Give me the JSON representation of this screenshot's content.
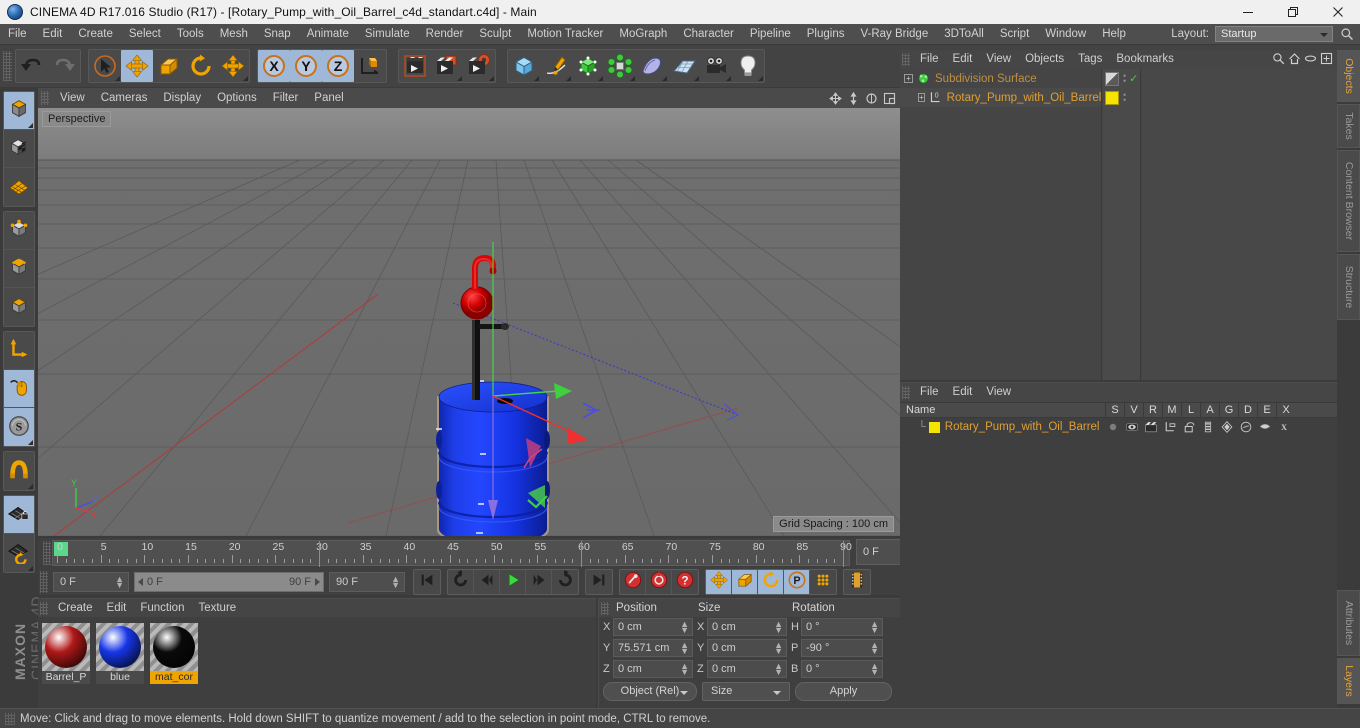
{
  "window": {
    "title": "CINEMA 4D R17.016 Studio (R17) - [Rotary_Pump_with_Oil_Barrel_c4d_standart.c4d] - Main",
    "app_icon": "cinema4d-logo-icon",
    "minimize": "minimize-icon",
    "maximize": "restore-icon",
    "close": "close-icon"
  },
  "menubar": {
    "items": [
      "File",
      "Edit",
      "Create",
      "Select",
      "Tools",
      "Mesh",
      "Snap",
      "Animate",
      "Simulate",
      "Render",
      "Sculpt",
      "Motion Tracker",
      "MoGraph",
      "Character",
      "Pipeline",
      "Plugins",
      "V-Ray Bridge",
      "3DToAll",
      "Script",
      "Window",
      "Help"
    ],
    "layout_label": "Layout:",
    "layout_value": "Startup",
    "search_icon": "search-icon"
  },
  "toolbar": {
    "groups": [
      {
        "name": "history",
        "buttons": [
          {
            "name": "undo-button",
            "icon": "undo-arrow-icon",
            "selected": false,
            "corner": false
          },
          {
            "name": "redo-button",
            "icon": "redo-arrow-icon",
            "selected": false,
            "corner": false
          }
        ]
      },
      {
        "name": "transform",
        "buttons": [
          {
            "name": "live-selection-tool",
            "icon": "cursor-circle-icon",
            "selected": false,
            "corner": true
          },
          {
            "name": "move-tool",
            "icon": "move-arrows-icon",
            "selected": true,
            "corner": false
          },
          {
            "name": "scale-tool",
            "icon": "scale-box-icon",
            "selected": false,
            "corner": false
          },
          {
            "name": "rotate-tool",
            "icon": "rotate-arc-icon",
            "selected": false,
            "corner": false
          },
          {
            "name": "transform-tool",
            "icon": "move-arrows-icon",
            "selected": false,
            "corner": true
          }
        ]
      },
      {
        "name": "axis-lock",
        "buttons": [
          {
            "name": "lock-x-axis",
            "icon": "x-axis-icon",
            "selected": true,
            "corner": false
          },
          {
            "name": "lock-y-axis",
            "icon": "y-axis-icon",
            "selected": true,
            "corner": false
          },
          {
            "name": "lock-z-axis",
            "icon": "z-axis-icon",
            "selected": true,
            "corner": false
          },
          {
            "name": "world-object-coordinates",
            "icon": "axis-cube-icon",
            "selected": false,
            "corner": false
          }
        ]
      },
      {
        "name": "render",
        "buttons": [
          {
            "name": "render-view-button",
            "icon": "clapper-view-icon",
            "selected": false,
            "corner": false
          },
          {
            "name": "render-to-picture-viewer",
            "icon": "clapper-picture-icon",
            "selected": false,
            "corner": true
          },
          {
            "name": "render-settings-button",
            "icon": "clapper-gear-icon",
            "selected": false,
            "corner": true
          }
        ]
      },
      {
        "name": "objects",
        "buttons": [
          {
            "name": "add-cube-object",
            "icon": "blue-cube-icon",
            "selected": false,
            "corner": true
          },
          {
            "name": "add-spline-object",
            "icon": "pen-spline-icon",
            "selected": false,
            "corner": true
          },
          {
            "name": "add-generator-object",
            "icon": "green-cube-icon",
            "selected": false,
            "corner": true
          },
          {
            "name": "add-deformer-object",
            "icon": "green-cluster-icon",
            "selected": false,
            "corner": true
          },
          {
            "name": "add-scene-object",
            "icon": "purple-shape-icon",
            "selected": false,
            "corner": true
          },
          {
            "name": "add-floor-object",
            "icon": "grid-plane-icon",
            "selected": false,
            "corner": true
          },
          {
            "name": "add-camera-object",
            "icon": "camera-icon",
            "selected": false,
            "corner": true
          },
          {
            "name": "add-light-object",
            "icon": "lightbulb-icon",
            "selected": false,
            "corner": true
          }
        ]
      }
    ]
  },
  "leftbar": {
    "groups": [
      [
        {
          "name": "model-mode",
          "icon": "model-cube-icon",
          "selected": true,
          "corner": true
        },
        {
          "name": "texture-mode",
          "icon": "texture-cube-icon",
          "selected": false,
          "corner": false
        },
        {
          "name": "workplane-mode",
          "icon": "workplane-grid-icon",
          "selected": false,
          "corner": false
        }
      ],
      [
        {
          "name": "points-mode",
          "icon": "points-cube-icon",
          "selected": false,
          "corner": false
        },
        {
          "name": "edges-mode",
          "icon": "edges-cube-icon",
          "selected": false,
          "corner": false
        },
        {
          "name": "polygons-mode",
          "icon": "polygons-cube-icon",
          "selected": false,
          "corner": false
        }
      ],
      [
        {
          "name": "object-axis-mode",
          "icon": "axis-l-icon",
          "selected": false,
          "corner": false
        },
        {
          "name": "enable-axis-modification",
          "icon": "mouse-axis-icon",
          "selected": true,
          "corner": false
        },
        {
          "name": "soft-selection-mode",
          "icon": "soft-selection-s-icon",
          "selected": true,
          "corner": true
        }
      ],
      [
        {
          "name": "enable-snapping",
          "icon": "magnet-icon",
          "selected": false,
          "corner": true
        }
      ],
      [
        {
          "name": "lock-workplane",
          "icon": "workplane-lock-icon",
          "selected": true,
          "corner": false
        },
        {
          "name": "workplane-rotate",
          "icon": "workplane-rotate-icon",
          "selected": false,
          "corner": true
        }
      ]
    ],
    "brand_line1": "MAXON",
    "brand_line2": "CINEMA 4D"
  },
  "viewport": {
    "menu": [
      "View",
      "Cameras",
      "Display",
      "Options",
      "Filter",
      "Panel"
    ],
    "corner_icons": [
      "move-viewport-icon",
      "zoom-viewport-icon",
      "rotate-viewport-icon",
      "maximize-viewport-icon"
    ],
    "label": "Perspective",
    "grid_spacing": "Grid Spacing : 100 cm",
    "axis_x": "X",
    "axis_y": "Y",
    "axis_z": "Z"
  },
  "timeline": {
    "start_frame_field": "0 F",
    "range_start": "0 F",
    "range_end": "90 F",
    "end_frame_field": "90 F",
    "current_frame_field": "0 F",
    "ticks": [
      0,
      5,
      10,
      15,
      20,
      25,
      30,
      35,
      40,
      45,
      50,
      55,
      60,
      65,
      70,
      75,
      80,
      85,
      90
    ],
    "transport": [
      {
        "name": "go-to-start-button",
        "icon": "skip-start-icon"
      },
      {
        "name": "play-backwards-loop-button",
        "icon": "loop-back-icon"
      },
      {
        "name": "step-back-button",
        "icon": "step-back-icon"
      },
      {
        "name": "play-button",
        "icon": "play-icon"
      },
      {
        "name": "step-forward-button",
        "icon": "step-forward-icon"
      },
      {
        "name": "play-forwards-loop-button",
        "icon": "loop-forward-icon"
      },
      {
        "name": "go-to-end-button",
        "icon": "skip-end-icon"
      }
    ],
    "record": [
      {
        "name": "record-active-objects-button",
        "icon": "record-key-icon"
      },
      {
        "name": "autokeying-button",
        "icon": "autokey-circle-icon"
      },
      {
        "name": "keyframe-selection-button",
        "icon": "keyframe-question-icon"
      }
    ],
    "keyflags": [
      {
        "name": "key-position-toggle",
        "icon": "move-arrows-icon",
        "selected": true
      },
      {
        "name": "key-scale-toggle",
        "icon": "scale-box-icon",
        "selected": true
      },
      {
        "name": "key-rotation-toggle",
        "icon": "rotate-arc-icon",
        "selected": true
      },
      {
        "name": "key-parameter-toggle",
        "icon": "parameter-p-icon",
        "selected": true
      },
      {
        "name": "key-pla-toggle",
        "icon": "pla-dots-icon",
        "selected": false
      }
    ],
    "extra": {
      "name": "timeline-mode-button",
      "icon": "filmstrip-icon"
    }
  },
  "materials": {
    "menu": [
      "Create",
      "Edit",
      "Function",
      "Texture"
    ],
    "items": [
      {
        "name": "Barrel_P",
        "color": "#b01818",
        "selected": false
      },
      {
        "name": "blue",
        "color": "#1736e8",
        "selected": false
      },
      {
        "name": "mat_cor",
        "color": "#0a0a0a",
        "selected": true
      }
    ]
  },
  "coordinates": {
    "headers": [
      "Position",
      "Size",
      "Rotation"
    ],
    "position": {
      "labels": [
        "X",
        "Y",
        "Z"
      ],
      "values": [
        "0 cm",
        "75.571 cm",
        "0 cm"
      ]
    },
    "size": {
      "labels": [
        "X",
        "Y",
        "Z"
      ],
      "values": [
        "0 cm",
        "0 cm",
        "0 cm"
      ]
    },
    "rotation": {
      "labels": [
        "H",
        "P",
        "B"
      ],
      "values": [
        "0 °",
        "-90 °",
        "0 °"
      ]
    },
    "mode_dropdown": "Object (Rel)",
    "size_dropdown": "Size",
    "apply_button": "Apply"
  },
  "object_manager": {
    "menu": [
      "File",
      "Edit",
      "View",
      "Objects",
      "Tags",
      "Bookmarks"
    ],
    "icons": [
      "search-icon",
      "home-icon",
      "ellipse-icon",
      "fit-icon"
    ],
    "rows": [
      {
        "label": "Subdivision Surface",
        "icon": "subdivision-surface-icon",
        "indent": 0,
        "tag_icon": "checker-tag-icon",
        "visible_dots": "visibility-dots-icon",
        "check": "green-check-icon"
      },
      {
        "label": "Rotary_Pump_with_Oil_Barrel",
        "icon": "polygon-object-icon",
        "indent": 1,
        "tag_icon": "yellow-material-tag-icon",
        "visible_dots": "visibility-dots-icon",
        "check": ""
      }
    ]
  },
  "layer_manager": {
    "menu": [
      "File",
      "Edit",
      "View"
    ],
    "columns": [
      "Name",
      "S",
      "V",
      "R",
      "M",
      "L",
      "A",
      "G",
      "D",
      "E",
      "X"
    ],
    "rows": [
      {
        "name": "Rotary_Pump_with_Oil_Barrel",
        "color": "#f5e400",
        "cells": [
          "solo-dot-icon",
          "visible-eye-icon",
          "render-clapper-icon",
          "manager-tree-icon",
          "unlocked-padlock-icon",
          "animation-bars-icon",
          "generator-icon",
          "deformer-icon",
          "expression-icon",
          "xref-icon"
        ]
      }
    ]
  },
  "vertical_tabs": {
    "top": [
      {
        "label": "Objects",
        "active": true
      },
      {
        "label": "Takes",
        "active": false
      },
      {
        "label": "Content Browser",
        "active": false
      },
      {
        "label": "Structure",
        "active": false
      }
    ],
    "bottom": [
      {
        "label": "Attributes",
        "active": false
      },
      {
        "label": "Layers",
        "active": true
      }
    ]
  },
  "statusbar": {
    "message": "Move: Click and drag to move elements. Hold down SHIFT to quantize movement / add to the selection in point mode, CTRL to remove."
  },
  "colors": {
    "panel_bg": "#3f3f3f",
    "toolbar_bg": "#434343",
    "selection_blue": "#9fb8d8",
    "accent_orange": "#e0a030",
    "highlight_yellow": "#f0a400",
    "axis_x_red": "#e03030",
    "axis_y_green": "#30c030",
    "axis_z_blue": "#4040e0"
  }
}
